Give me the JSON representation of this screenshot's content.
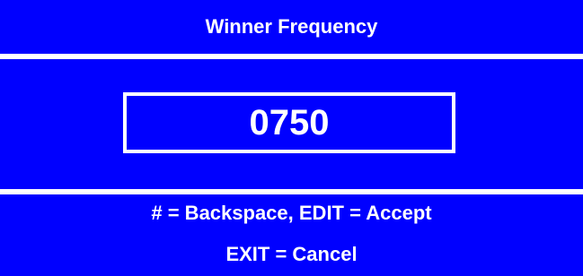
{
  "title": "Winner Frequency",
  "value": "0750",
  "instructions": {
    "line1": "# = Backspace, EDIT = Accept",
    "line2": "EXIT = Cancel"
  },
  "colors": {
    "panel": "#0000ff",
    "text": "#ffffff",
    "separator": "#ffffff"
  }
}
